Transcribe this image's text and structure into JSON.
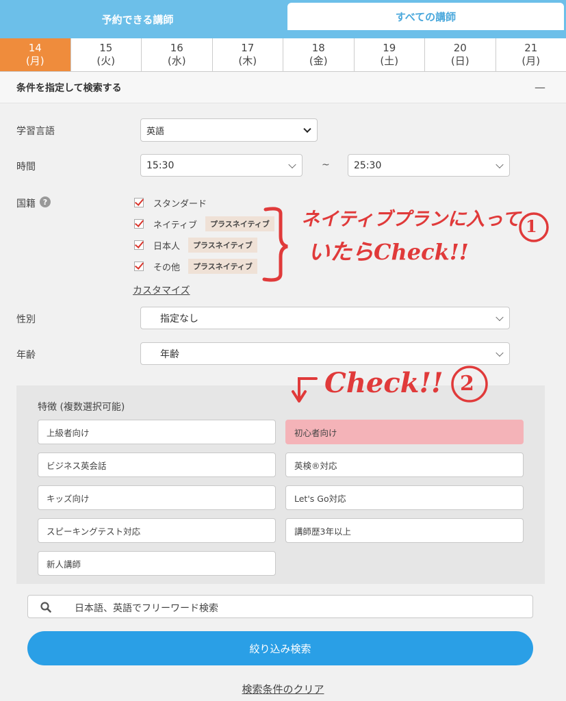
{
  "tabs": {
    "active": "予約できる講師",
    "inactive": "すべての講師"
  },
  "dates": [
    {
      "day": "14",
      "dow": "(月)"
    },
    {
      "day": "15",
      "dow": "(火)"
    },
    {
      "day": "16",
      "dow": "(水)"
    },
    {
      "day": "17",
      "dow": "(木)"
    },
    {
      "day": "18",
      "dow": "(金)"
    },
    {
      "day": "19",
      "dow": "(土)"
    },
    {
      "day": "20",
      "dow": "(日)"
    },
    {
      "day": "21",
      "dow": "(月)"
    }
  ],
  "conditions": {
    "title": "条件を指定して検索する",
    "collapse": "—"
  },
  "language": {
    "label": "学習言語",
    "value": "英語"
  },
  "time": {
    "label": "時間",
    "from": "15:30",
    "separator": "~",
    "to": "25:30"
  },
  "nationality": {
    "label": "国籍",
    "help": "?",
    "options": [
      {
        "label": "スタンダード",
        "badge": ""
      },
      {
        "label": "ネイティブ",
        "badge": "プラスネイティブ"
      },
      {
        "label": "日本人",
        "badge": "プラスネイティブ"
      },
      {
        "label": "その他",
        "badge": "プラスネイティブ"
      }
    ],
    "customize": "カスタマイズ"
  },
  "gender": {
    "label": "性別",
    "value": "指定なし"
  },
  "age": {
    "label": "年齢",
    "value": "年齢"
  },
  "features": {
    "title": "特徴 (複数選択可能)",
    "items": [
      "上級者向け",
      "初心者向け",
      "ビジネス英会話",
      "英検®対応",
      "キッズ向け",
      "Let's Go対応",
      "スピーキングテスト対応",
      "講師歴3年以上",
      "新人講師"
    ]
  },
  "search": {
    "placeholder": "日本語、英語でフリーワード検索"
  },
  "submit": "絞り込み検索",
  "clear": "検索条件のクリア",
  "annotations": {
    "note1_line1": "ネイティブプランに入って",
    "note1_line2": "いたらCheck!!",
    "num1": "①",
    "note2": "Check!!",
    "num2": "②"
  },
  "colors": {
    "tab_blue": "#6cbfe9",
    "date_active": "#ef8c3c",
    "feature_selected": "#f4b3b8",
    "submit_blue": "#2a9fe6",
    "check_red": "#d9342b",
    "annotation_red": "#e03a3a"
  }
}
